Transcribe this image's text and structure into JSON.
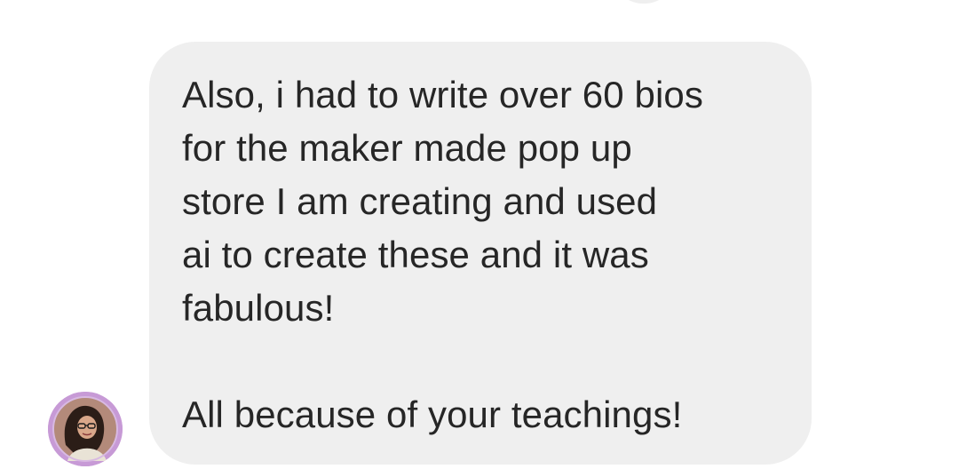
{
  "conversation": {
    "message": {
      "lines": [
        "Also, i had to write over 60 bios",
        "for the maker made pop up",
        "store I am creating and used",
        "ai to create these and it was",
        "fabulous!"
      ],
      "closing_line": "All because of your teachings!"
    },
    "sender_avatar_icon": "profile-photo",
    "colors": {
      "bubble_background": "#efefef",
      "text": "#262626",
      "avatar_ring": "#c79ad6"
    }
  }
}
